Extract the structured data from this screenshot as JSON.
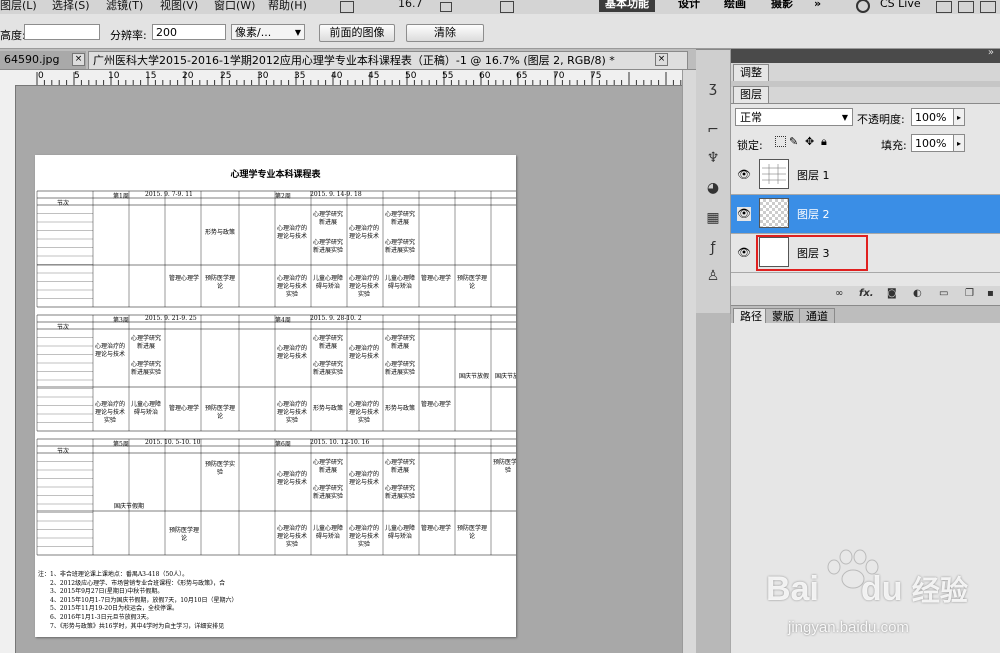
{
  "menubar": {
    "items": [
      "图层(L)",
      "选择(S)",
      "滤镜(T)",
      "视图(V)",
      "窗口(W)",
      "帮助(H)"
    ],
    "zoom_value": "16.7",
    "workspace_active": "基本功能",
    "workspace_items": [
      "设计",
      "绘画",
      "摄影"
    ],
    "more": "»",
    "cs_live": "CS Live"
  },
  "options_bar": {
    "height_label": "高度:",
    "height_value": "",
    "resolution_label": "分辨率:",
    "resolution_value": "200",
    "unit_value": "像素/...",
    "front_image_button": "前面的图像",
    "clear_button": "清除"
  },
  "tabs": {
    "tab1": "64590.jpg",
    "tab2": "广州医科大学2015-2016-1学期2012应用心理学专业本科课程表（正稿）-1 @ 16.7% (图层 2, RGB/8) *",
    "close": "×"
  },
  "ruler": {
    "labels": [
      "0",
      "5",
      "10",
      "15",
      "20",
      "25",
      "30",
      "35",
      "40",
      "45",
      "50",
      "55",
      "60",
      "65",
      "70",
      "75"
    ]
  },
  "document": {
    "title": "心理学专业本科课程表",
    "weeks": {
      "w1": "第1周",
      "w1_dates": "2015. 9. 7-9. 11",
      "w2": "第2周",
      "w2_dates": "2015. 9. 14-9. 18",
      "w3": "第3周",
      "w3_dates": "2015. 9. 21-9. 25",
      "w4": "第4周",
      "w4_dates": "2015. 9. 28-10. 2",
      "w5": "第5周",
      "w5_dates": "2015. 10. 5-10. 10",
      "w6": "第6周",
      "w6_dates": "2015. 10. 12-10. 16"
    },
    "section_label": "节次",
    "courses": {
      "c_xingshi": "形势与政策",
      "c_zhiliao": "心理治疗的理论与技术",
      "c_yanjiu": "心理学研究新进展",
      "c_guanli": "管理心理学",
      "c_yufang": "预防医学理论",
      "c_ertong": "儿童心理障碍与矫治",
      "c_shiyan": "心理治疗的理论与技术实验",
      "c_yanjiu_sy": "心理学研究新进展实验",
      "c_guoqing": "国庆节放假",
      "c_guoqing2": "国庆节假期",
      "c_yufang_sy": "预防医学实验"
    },
    "notes": [
      "注：1、非合班理论课上课地点：番禺A3-418（50人）。",
      "2、2012级应心理学、市场营销专业合班课程：《形势与政策》，合",
      "3、2015年9月27日(星期日)中秋节假期。",
      "4、2015年10月1-7日为国庆节假期，放假7天，10月10日（星期六）",
      "5、2015年11月19-20日为校运会，全校停课。",
      "6、2016年1月1-3日元旦节放假3天。",
      "7、《形势与政策》共16学时，其中4学时为自主学习，详细安排见"
    ]
  },
  "panels": {
    "adjust_tab": "调整",
    "layers_tab": "图层",
    "blend_mode": "正常",
    "opacity_label": "不透明度:",
    "opacity_value": "100%",
    "lock_label": "锁定:",
    "fill_label": "填充:",
    "fill_value": "100%",
    "layers": [
      "图层 1",
      "图层 2",
      "图层 3"
    ],
    "lower_tabs": [
      "路径",
      "蒙版",
      "通道"
    ]
  },
  "watermark": {
    "brand": "Bai",
    "brand2": "du",
    "suffix": "经验",
    "url": "jingyan.baidu.com"
  },
  "colors": {
    "selected_layer": "#3a8ee6",
    "highlight_box": "#e0201f",
    "baidu_red": "#e10602",
    "baidu_blue": "#2932e1"
  }
}
